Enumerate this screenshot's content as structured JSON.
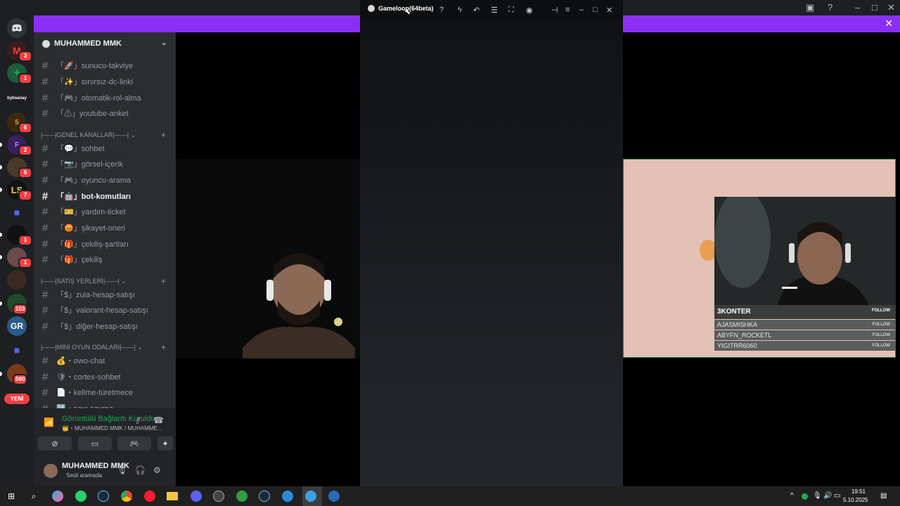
{
  "gameloop": {
    "title": "Gameloop(64beta)"
  },
  "server": {
    "name": "MUHAMMED MMK"
  },
  "channels_top": [
    {
      "label": "「🚀」sunucu-takviye"
    },
    {
      "label": "「✨」sınırsız-dc-linki"
    },
    {
      "label": "「🎮」otomatik-rol-alma"
    },
    {
      "label": "「⚠」youtube-anket"
    }
  ],
  "categories": {
    "genel": "|——|GENEL KANALLAR|——|",
    "satis": "|——|SATIŞ YERLERİ|——|",
    "mini": "|——|MİNİ OYUN ODALARI|——|"
  },
  "channels_genel": [
    {
      "label": "「💬」sohbet"
    },
    {
      "label": "「📷」görsel-içerik"
    },
    {
      "label": "「🎮」oyuncu-arama"
    },
    {
      "label": "「🤖」bot-komutları"
    },
    {
      "label": "「🎫」yardım-ticket"
    },
    {
      "label": "「😡」şikayet-oneri"
    },
    {
      "label": "「🎁」çekiliş-şartları"
    },
    {
      "label": "「🎁」çekiliş"
    }
  ],
  "channels_satis": [
    {
      "label": "「$」zula-hesap-satışı"
    },
    {
      "label": "「$」valorant-hesap-satışı"
    },
    {
      "label": "「$」diğer-hesap-satışı"
    }
  ],
  "channels_mini": [
    {
      "label": "💰・owo-chat"
    },
    {
      "label": "🛡・cortex-sohbet"
    },
    {
      "label": "📄・kelime-türetmece"
    },
    {
      "label": "🔢・sayı-sayma"
    }
  ],
  "voice": {
    "status": "Görüntülü Bağlantı Kuruldu",
    "sub": "👑・MUHAMMED MMK / MUHAMME..."
  },
  "user": {
    "name": "MUHAMMED MMK",
    "status": "Sesli aramada"
  },
  "servers": {
    "badges": [
      "3",
      "1",
      "6",
      "2",
      "6",
      "7",
      "1",
      "1",
      "103",
      "560"
    ],
    "label_bybsanay": "bybsanay",
    "new_pill": "YENİ"
  },
  "overlay": {
    "streamer": "3KONTER",
    "follow_tag": "FOLLOW",
    "followers": [
      "AJASMISHKA",
      "ABYFN_ROCKETL",
      "YIGITRR6060"
    ]
  },
  "clock": {
    "time": "19:51",
    "date": "5.10.2025"
  },
  "colors": {
    "banner": "#8c2ff5",
    "online": "#23a55a",
    "badge": "#f23f43"
  }
}
